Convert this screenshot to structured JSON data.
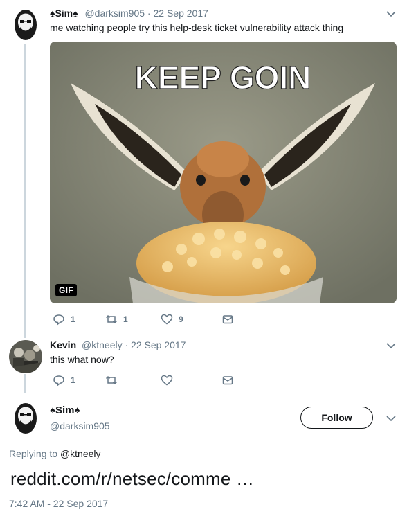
{
  "tweet1": {
    "display_name": "♠Sim♠",
    "handle": "@darksim905",
    "date": "22 Sep 2017",
    "text": "me watching people try this help-desk ticket vulnerability attack thing",
    "media_caption": "KEEP GOIN",
    "media_badge": "GIF",
    "reply_count": "1",
    "retweet_count": "1",
    "like_count": "9"
  },
  "tweet2": {
    "display_name": "Kevin",
    "handle": "@ktneely",
    "date": "22 Sep 2017",
    "text": "this what now?",
    "reply_count": "1",
    "retweet_count": "",
    "like_count": ""
  },
  "main_tweet": {
    "display_name": "♠Sim♠",
    "handle": "@darksim905",
    "follow_label": "Follow",
    "replying_prefix": "Replying to",
    "replying_handle": "@ktneely",
    "text": "reddit.com/r/netsec/comme  …",
    "timestamp": "7:42 AM - 22 Sep 2017"
  },
  "colors": {
    "text_primary": "#14171a",
    "text_secondary": "#657786",
    "thread_line": "#ccd6dd"
  }
}
